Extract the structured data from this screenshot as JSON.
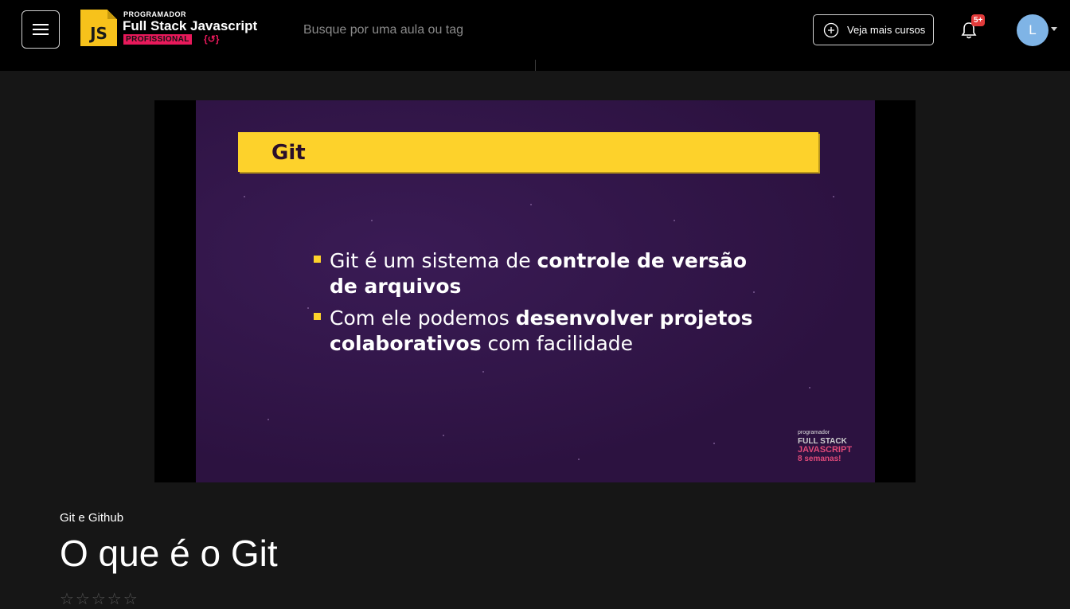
{
  "header": {
    "menu_icon": "hamburger-menu-icon",
    "logo": {
      "badge_text": "JS",
      "line1": "PROGRAMADOR",
      "line2": "Full Stack Javascript",
      "line3": "PROFISSIONAL",
      "line3_badge": "{↺}"
    },
    "search": {
      "placeholder": "Busque por uma aula ou tag",
      "value": ""
    },
    "more_courses_button": {
      "label": "Veja mais cursos",
      "icon": "plus-circle-icon"
    },
    "notifications": {
      "icon": "bell-icon",
      "badge": "5+"
    },
    "user": {
      "avatar_initial": "L",
      "caret_icon": "caret-down-icon"
    }
  },
  "video": {
    "slide_title": "Git",
    "bullets": [
      {
        "parts": [
          {
            "text": "Git é um sistema de ",
            "bold": false
          },
          {
            "text": "controle de versão de arquivos",
            "bold": true
          }
        ]
      },
      {
        "parts": [
          {
            "text": "Com ele podemos ",
            "bold": false
          },
          {
            "text": "desenvolver projetos colaborativos",
            "bold": true
          },
          {
            "text": " com facilidade",
            "bold": false
          }
        ]
      }
    ],
    "watermark": {
      "line1": "programador",
      "line2": "FULL STACK",
      "line3": "JAVASCRIPT",
      "line4": "8 semanas!"
    }
  },
  "lesson": {
    "module": "Git e Github",
    "title": "O que é o Git",
    "rating_stars": 0,
    "rating_max": 5
  },
  "colors": {
    "header_bg": "#000000",
    "page_bg": "#161616",
    "slide_bg": "#2c1240",
    "slide_accent": "#fdd22b",
    "logo_pink": "#e8195b",
    "notif_badge": "#e23b3b",
    "avatar": "#7fb4e6"
  }
}
